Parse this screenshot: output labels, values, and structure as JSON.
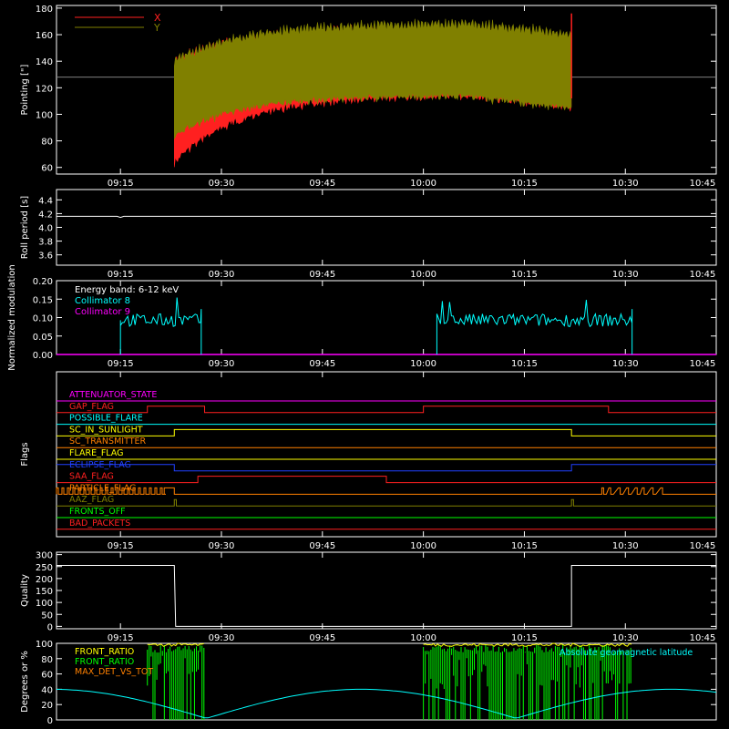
{
  "chart_data": [
    {
      "type": "line",
      "ylabel": "Pointing [\"]",
      "ylim": [
        55,
        182
      ],
      "yticks": [
        "60",
        "80",
        "100",
        "120",
        "140",
        "160",
        "180"
      ],
      "xlim_minutes": [
        0,
        98
      ],
      "xticks": [
        "09:15",
        "09:30",
        "09:45",
        "10:00",
        "10:15",
        "10:30",
        "10:45"
      ],
      "xtick_minutes": [
        9.5,
        24.5,
        39.5,
        54.5,
        69.5,
        84.5,
        99.5
      ],
      "reference_line_y": 128,
      "data_window_minutes": [
        17.5,
        76.5
      ],
      "series": [
        {
          "name": "X",
          "color": "#ff2020",
          "band_max": 165,
          "band_min": 68
        },
        {
          "name": "Y",
          "color": "#808000",
          "band_max": 170,
          "band_min": 80
        }
      ],
      "legend_position": "top-left"
    },
    {
      "type": "line",
      "ylabel": "Roll period [s]",
      "ylim": [
        3.45,
        4.55
      ],
      "yticks": [
        "3.6",
        "3.8",
        "4.0",
        "4.2",
        "4.4"
      ],
      "xticks": [
        "09:15",
        "09:30",
        "09:45",
        "10:00",
        "10:15",
        "10:30",
        "10:45"
      ],
      "series": [
        {
          "name": "",
          "color": "#ffffff",
          "value": 4.16
        }
      ]
    },
    {
      "type": "line",
      "ylabel": "Normalized modulation",
      "ylim": [
        0,
        0.2
      ],
      "yticks": [
        "0.00",
        "0.05",
        "0.10",
        "0.15",
        "0.20"
      ],
      "xticks": [
        "09:15",
        "09:30",
        "09:45",
        "10:00",
        "10:15",
        "10:30",
        "10:45"
      ],
      "legend_title": "Energy band: 6-12 keV",
      "series": [
        {
          "name": "Collimator 8",
          "color": "#00ffff",
          "segments": [
            [
              9.5,
              21.5
            ],
            [
              56.5,
              85.5
            ]
          ],
          "value": 0.093
        },
        {
          "name": "Collimator 9",
          "color": "#ff00ff",
          "value": 0.0
        }
      ]
    },
    {
      "type": "line",
      "ylabel": "Flags",
      "xticks": [
        "09:15",
        "09:30",
        "09:45",
        "10:00",
        "10:15",
        "10:30",
        "10:45"
      ],
      "flags": [
        {
          "name": "ATTENUATOR_STATE",
          "color": "#ff00ff"
        },
        {
          "name": "GAP_FLAG",
          "color": "#ff2020"
        },
        {
          "name": "POSSIBLE_FLARE",
          "color": "#00ffff"
        },
        {
          "name": "SC_IN_SUNLIGHT",
          "color": "#ffff00"
        },
        {
          "name": "SC_TRANSMITTER",
          "color": "#ff8000"
        },
        {
          "name": "FLARE_FLAG",
          "color": "#ffff00"
        },
        {
          "name": "ECLIPSE_FLAG",
          "color": "#2040ff"
        },
        {
          "name": "SAA_FLAG",
          "color": "#ff2020"
        },
        {
          "name": "PARTICLE_FLAG",
          "color": "#ff8000"
        },
        {
          "name": "AAZ_FLAG",
          "color": "#808000"
        },
        {
          "name": "FRONTS_OFF",
          "color": "#00ff00"
        },
        {
          "name": "BAD_PACKETS",
          "color": "#ff2020"
        }
      ]
    },
    {
      "type": "line",
      "ylabel": "Quality",
      "ylim": [
        -10,
        310
      ],
      "yticks": [
        "0",
        "50",
        "100",
        "150",
        "200",
        "250",
        "300"
      ],
      "xticks": [
        "09:15",
        "09:30",
        "09:45",
        "10:00",
        "10:15",
        "10:30",
        "10:45"
      ],
      "series": [
        {
          "name": "",
          "color": "#ffffff",
          "high": 255,
          "low": 0,
          "high_segments": [
            [
              0,
              17.5
            ],
            [
              76.5,
              98
            ]
          ]
        }
      ]
    },
    {
      "type": "line",
      "ylabel": "Degrees or %",
      "ylim": [
        0,
        100
      ],
      "yticks": [
        "0",
        "20",
        "40",
        "60",
        "80",
        "100"
      ],
      "series": [
        {
          "name": "FRONT_RATIO",
          "color": "#ffff00"
        },
        {
          "name": "FRONT_RATIO",
          "color": "#00ff00"
        },
        {
          "name": "MAX_DET_VS_TOT",
          "color": "#ff8000"
        },
        {
          "name": "Absolute geomagnetic latitude",
          "color": "#00ffff",
          "max": 40,
          "min": 0
        }
      ]
    }
  ],
  "colors": {
    "background": "#000000",
    "axes": "#ffffff"
  }
}
